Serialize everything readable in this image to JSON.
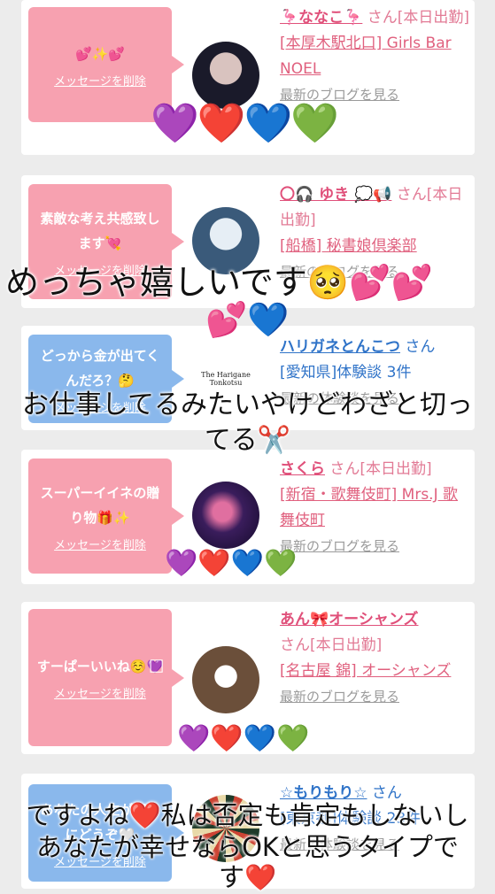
{
  "cards": [
    {
      "bubble": "💕✨💕",
      "delete": "メッセージを削除",
      "name": "🦩ななこ🦩",
      "san": "さん[本日出勤]",
      "shop": "[本厚木駅北口] Girls Bar NOEL",
      "blog": "最新のブログを見る"
    },
    {
      "bubble": "素敵な考え共感致します💘",
      "delete": "メッセージを削除",
      "name": "〇🎧 ゆき 💭📢",
      "san": "さん[本日出勤]",
      "shop": "[船橋] 秘書娘倶楽部",
      "blog": "最新のブログを見る"
    },
    {
      "bubble": "どっから金が出てくんだろ？🤔",
      "delete": "メッセージを削除",
      "name": "ハリガネとんこつ",
      "san": "さん",
      "shop": "[愛知県]体験談 3件",
      "blog": "最新の体験談を見る",
      "avatar_text": "The Harigane Tonkotsu"
    },
    {
      "bubble": "スーパーイイネの贈り物🎁✨",
      "delete": "メッセージを削除",
      "name": "さくら",
      "san": "さん[本日出勤]",
      "shop": "[新宿・歌舞伎町] Mrs.J 歌舞伎町",
      "blog": "最新のブログを見る"
    },
    {
      "bubble": "すーぱーいいね☺️💜⃞",
      "delete": "メッセージを削除",
      "name": "あん🎀オーシャンズ",
      "san": "さん[本日出勤]",
      "shop": "[名古屋 錦] オーシャンズ",
      "blog": "最新のブログを見る"
    },
    {
      "bubble": "あなたの人生が好きにどうぞ🤍",
      "delete": "メッセージを削除",
      "name": "☆もりもり☆",
      "san": "さん",
      "shop": "[東京都]体験談 23件",
      "blog": "最新の体験談を見る"
    }
  ],
  "hearts": {
    "row1": "💜❤️💙💚",
    "row4": "💜❤️💙💚",
    "row5": "💜❤️💙💚",
    "mid": "💕💕",
    "mid2": "💕💙"
  },
  "overlays": {
    "line1": "めっちゃ嬉しいです🥺💕💕",
    "line2a": "お仕事してるみたいやけどわざと切っ",
    "line2b": "てる✂️",
    "line3a": "ですよね❤️私は否定も肯定もしないし",
    "line3b": "あなたが幸せならOKと思うタイプで",
    "line3c": "す❤️"
  },
  "colors": {
    "pink_bubble": "#f7a1b0",
    "blue_bubble": "#8ab8ec",
    "name_pink": "#e0507a",
    "name_blue": "#2f73c8"
  }
}
